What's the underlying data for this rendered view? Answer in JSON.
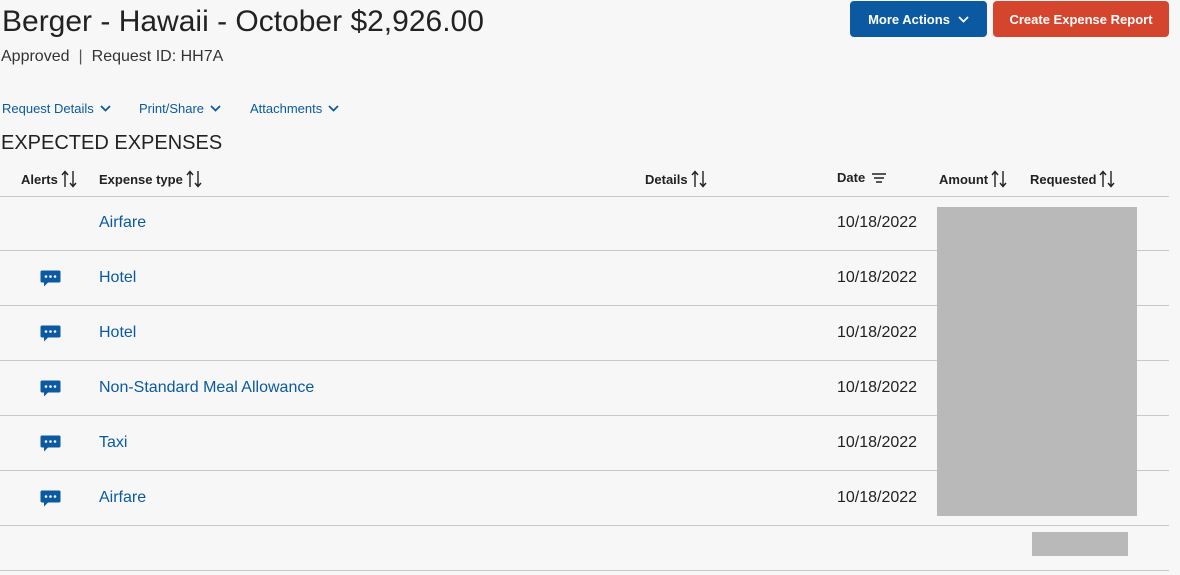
{
  "header": {
    "title": "Berger - Hawaii - October $2,926.00",
    "status": "Approved",
    "separator": "|",
    "request_id": "Request ID: HH7A",
    "more_actions_label": "More Actions",
    "create_report_label": "Create Expense Report"
  },
  "menu": {
    "items": [
      {
        "label": "Request Details"
      },
      {
        "label": "Print/Share"
      },
      {
        "label": "Attachments"
      }
    ]
  },
  "section": {
    "title": "EXPECTED EXPENSES"
  },
  "table": {
    "columns": {
      "alerts": "Alerts",
      "expense_type": "Expense type",
      "details": "Details",
      "date": "Date",
      "amount": "Amount",
      "requested": "Requested"
    },
    "rows": [
      {
        "expense_type": "Airfare",
        "date": "10/18/2022",
        "has_alert": false
      },
      {
        "expense_type": "Hotel",
        "date": "10/18/2022",
        "has_alert": true
      },
      {
        "expense_type": "Hotel",
        "date": "10/18/2022",
        "has_alert": true
      },
      {
        "expense_type": "Non-Standard Meal Allowance",
        "date": "10/18/2022",
        "has_alert": true
      },
      {
        "expense_type": "Taxi",
        "date": "10/18/2022",
        "has_alert": true
      },
      {
        "expense_type": "Airfare",
        "date": "10/18/2022",
        "has_alert": true
      }
    ]
  },
  "icons": {
    "alert": "comment-icon",
    "sort": "sort-arrows-icon",
    "filter": "filter-lines-icon",
    "chevron": "chevron-down-icon"
  },
  "colors": {
    "primary_blue": "#0b5aa1",
    "create_red": "#d5452d",
    "redacted_gray": "#b9b9b9"
  }
}
